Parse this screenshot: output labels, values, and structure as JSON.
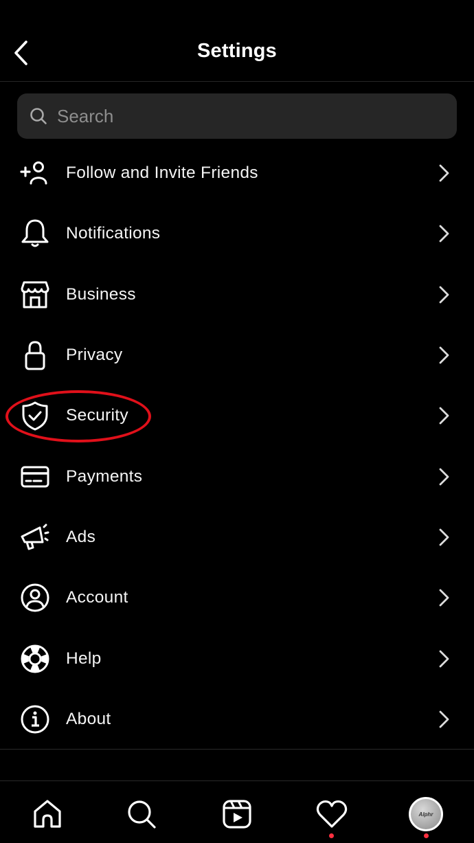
{
  "header": {
    "title": "Settings",
    "back_icon": "chevron-left-icon"
  },
  "search": {
    "placeholder": "Search",
    "value": "",
    "icon": "search-icon"
  },
  "menu": {
    "items": [
      {
        "label": "Follow and Invite Friends",
        "icon": "add-person-icon"
      },
      {
        "label": "Notifications",
        "icon": "bell-icon"
      },
      {
        "label": "Business",
        "icon": "storefront-icon"
      },
      {
        "label": "Privacy",
        "icon": "lock-icon"
      },
      {
        "label": "Security",
        "icon": "shield-check-icon",
        "highlighted": true
      },
      {
        "label": "Payments",
        "icon": "credit-card-icon"
      },
      {
        "label": "Ads",
        "icon": "megaphone-icon"
      },
      {
        "label": "Account",
        "icon": "user-circle-icon"
      },
      {
        "label": "Help",
        "icon": "lifebuoy-icon"
      },
      {
        "label": "About",
        "icon": "info-icon"
      }
    ]
  },
  "annotation": {
    "color": "#e0101a",
    "target": "Security"
  },
  "tabbar": {
    "items": [
      {
        "name": "home",
        "icon": "home-icon"
      },
      {
        "name": "search",
        "icon": "search-icon"
      },
      {
        "name": "reels",
        "icon": "reels-icon"
      },
      {
        "name": "activity",
        "icon": "heart-icon",
        "notification_dot": true
      },
      {
        "name": "profile",
        "icon": "avatar",
        "notification_dot": true,
        "avatar_text": "Alphr"
      }
    ],
    "dot_color": "#ff3040"
  }
}
